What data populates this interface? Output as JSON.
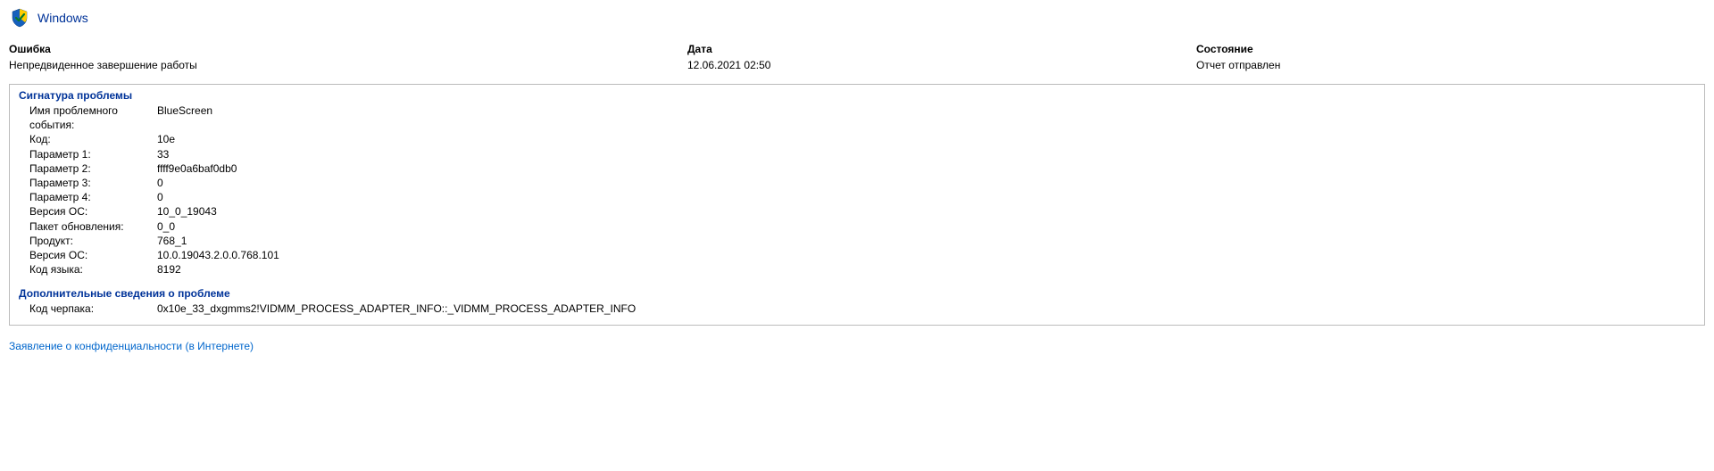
{
  "header": {
    "title": "Windows"
  },
  "summary": {
    "col1_header": "Ошибка",
    "col1_value": "Непредвиденное завершение работы",
    "col2_header": "Дата",
    "col2_value": "12.06.2021 02:50",
    "col3_header": "Состояние",
    "col3_value": "Отчет отправлен"
  },
  "signature": {
    "title": "Сигнатура проблемы",
    "rows": [
      {
        "k": "Имя проблемного события:",
        "v": "BlueScreen"
      },
      {
        "k": "Код:",
        "v": "10e"
      },
      {
        "k": "Параметр 1:",
        "v": "33"
      },
      {
        "k": "Параметр 2:",
        "v": "ffff9e0a6baf0db0"
      },
      {
        "k": "Параметр 3:",
        "v": "0"
      },
      {
        "k": "Параметр 4:",
        "v": "0"
      },
      {
        "k": "Версия ОС:",
        "v": "10_0_19043"
      },
      {
        "k": "Пакет обновления:",
        "v": "0_0"
      },
      {
        "k": "Продукт:",
        "v": "768_1"
      },
      {
        "k": "Версия ОС:",
        "v": "10.0.19043.2.0.0.768.101"
      },
      {
        "k": "Код языка:",
        "v": "8192"
      }
    ]
  },
  "additional": {
    "title": "Дополнительные сведения о проблеме",
    "rows": [
      {
        "k": "Код черпака:",
        "v": "0x10e_33_dxgmms2!VIDMM_PROCESS_ADAPTER_INFO::_VIDMM_PROCESS_ADAPTER_INFO"
      }
    ]
  },
  "privacy_link": "Заявление о конфиденциальности (в Интернете)"
}
